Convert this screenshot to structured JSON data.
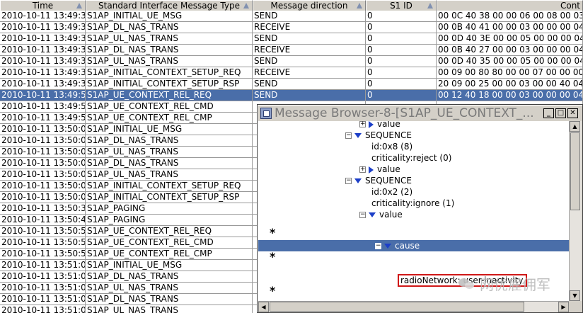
{
  "table": {
    "columns": [
      "Time",
      "Standard Interface Message Type",
      "Message direction",
      "S1 ID",
      "Cont"
    ],
    "rows": [
      [
        "2010-10-11 13:49:3...",
        "S1AP_INITIAL_UE_MSG",
        "SEND",
        "0",
        "00 0C 40 38 00 00 06 00 08 00 03 40 0"
      ],
      [
        "2010-10-11 13:49:3...",
        "S1AP_DL_NAS_TRANS",
        "RECEIVE",
        "0",
        "00 0B 40 41 00 00 03 00 00 00 04 80"
      ],
      [
        "2010-10-11 13:49:3...",
        "S1AP_UL_NAS_TRANS",
        "SEND",
        "0",
        "00 0D 40 3E 00 00 05 00 00 00 04 80"
      ],
      [
        "2010-10-11 13:49:3...",
        "S1AP_DL_NAS_TRANS",
        "RECEIVE",
        "0",
        "00 0B 40 27 00 00 03 00 00 00 04 80"
      ],
      [
        "2010-10-11 13:49:3...",
        "S1AP_UL_NAS_TRANS",
        "SEND",
        "0",
        "00 0D 40 35 00 00 05 00 00 00 04 80"
      ],
      [
        "2010-10-11 13:49:3...",
        "S1AP_INITIAL_CONTEXT_SETUP_REQ",
        "RECEIVE",
        "0",
        "00 09 00 80 80 00 00 07 00 00 00 04"
      ],
      [
        "2010-10-11 13:49:3...",
        "S1AP_INITIAL_CONTEXT_SETUP_RSP",
        "SEND",
        "0",
        "20 09 00 25 00 00 03 00 00 40 04 80"
      ],
      [
        "2010-10-11 13:49:5...",
        "S1AP_UE_CONTEXT_REL_REQ",
        "SEND",
        "0",
        "00 12 40 18 00 00 03 00 00 00 04 80"
      ],
      [
        "2010-10-11 13:49:5...",
        "S1AP_UE_CONTEXT_REL_CMD",
        "",
        "",
        ""
      ],
      [
        "2010-10-11 13:49:5...",
        "S1AP_UE_CONTEXT_REL_CMP",
        "",
        "",
        ""
      ],
      [
        "2010-10-11 13:50:0...",
        "S1AP_INITIAL_UE_MSG",
        "",
        "",
        ""
      ],
      [
        "2010-10-11 13:50:0...",
        "S1AP_DL_NAS_TRANS",
        "",
        "",
        ""
      ],
      [
        "2010-10-11 13:50:0...",
        "S1AP_UL_NAS_TRANS",
        "",
        "",
        ""
      ],
      [
        "2010-10-11 13:50:0...",
        "S1AP_DL_NAS_TRANS",
        "",
        "",
        ""
      ],
      [
        "2010-10-11 13:50:0...",
        "S1AP_UL_NAS_TRANS",
        "",
        "",
        ""
      ],
      [
        "2010-10-11 13:50:0...",
        "S1AP_INITIAL_CONTEXT_SETUP_REQ",
        "",
        "",
        ""
      ],
      [
        "2010-10-11 13:50:0...",
        "S1AP_INITIAL_CONTEXT_SETUP_RSP",
        "",
        "",
        ""
      ],
      [
        "2010-10-11 13:50:3...",
        "S1AP_PAGING",
        "",
        "",
        ""
      ],
      [
        "2010-10-11 13:50:4...",
        "S1AP_PAGING",
        "",
        "",
        ""
      ],
      [
        "2010-10-11 13:50:5...",
        "S1AP_UE_CONTEXT_REL_REQ",
        "",
        "",
        ""
      ],
      [
        "2010-10-11 13:50:5...",
        "S1AP_UE_CONTEXT_REL_CMD",
        "",
        "",
        ""
      ],
      [
        "2010-10-11 13:50:5...",
        "S1AP_UE_CONTEXT_REL_CMP",
        "",
        "",
        ""
      ],
      [
        "2010-10-11 13:51:0...",
        "S1AP_INITIAL_UE_MSG",
        "",
        "",
        ""
      ],
      [
        "2010-10-11 13:51:0...",
        "S1AP_DL_NAS_TRANS",
        "",
        "",
        ""
      ],
      [
        "2010-10-11 13:51:0...",
        "S1AP_UL_NAS_TRANS",
        "",
        "",
        ""
      ],
      [
        "2010-10-11 13:51:0...",
        "S1AP_DL_NAS_TRANS",
        "",
        "",
        ""
      ],
      [
        "2010-10-11 13:51:0...",
        "S1AP_UL_NAS_TRANS",
        "",
        "",
        ""
      ]
    ],
    "selected_row": 7
  },
  "browser": {
    "title": "Message Browser-8-[S1AP_UE_CONTEXT_...",
    "nodes": {
      "value_top": "value",
      "seq1": "SEQUENCE",
      "seq1_id": "id:0x8 (8)",
      "seq1_crit": "criticality:reject (0)",
      "seq1_value": "value",
      "seq2": "SEQUENCE",
      "seq2_id": "id:0x2 (2)",
      "seq2_crit": "criticality:ignore (1)",
      "seq2_value": "value",
      "cause": "cause",
      "cause_value": "radioNetwork: user-inactivity (20)"
    },
    "stars": [
      "*",
      "*",
      "*"
    ]
  },
  "watermark": "网优雇佣军"
}
